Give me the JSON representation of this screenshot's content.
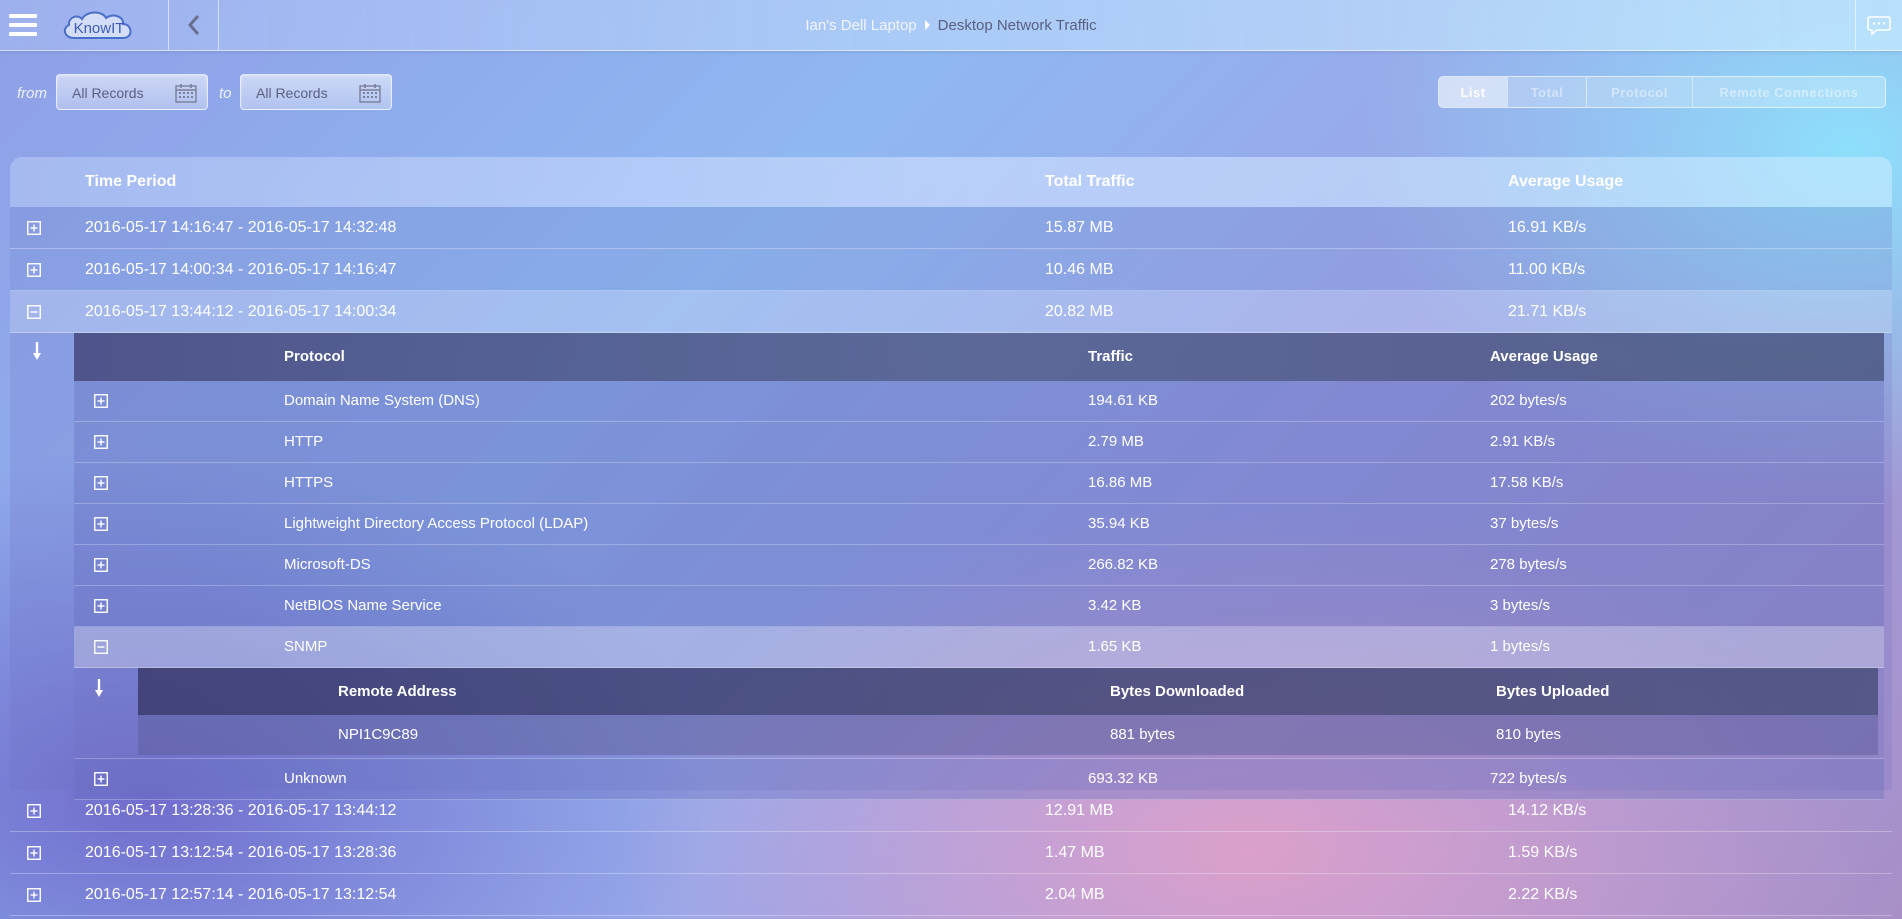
{
  "header": {
    "logo_text": "KnowIT",
    "breadcrumb_device": "Ian's Dell Laptop",
    "breadcrumb_page": "Desktop Network Traffic"
  },
  "filter": {
    "from_label": "from",
    "from_value": "All Records",
    "to_label": "to",
    "to_value": "All Records"
  },
  "view_tabs": [
    "List",
    "Total",
    "Protocol",
    "Remote Connections"
  ],
  "active_tab": "List",
  "table": {
    "columns": [
      "Time Period",
      "Total Traffic",
      "Average Usage"
    ],
    "rows_before": [
      {
        "period": "2016-05-17 14:16:47 - 2016-05-17 14:32:48",
        "traffic": "15.87 MB",
        "avg": "16.91 KB/s"
      },
      {
        "period": "2016-05-17 14:00:34 - 2016-05-17 14:16:47",
        "traffic": "10.46 MB",
        "avg": "11.00 KB/s"
      }
    ],
    "expanded_row": {
      "period": "2016-05-17 13:44:12 - 2016-05-17 14:00:34",
      "traffic": "20.82 MB",
      "avg": "21.71 KB/s"
    },
    "rows_after": [
      {
        "period": "2016-05-17 13:28:36 - 2016-05-17 13:44:12",
        "traffic": "12.91 MB",
        "avg": "14.12 KB/s"
      },
      {
        "period": "2016-05-17 13:12:54 - 2016-05-17 13:28:36",
        "traffic": "1.47 MB",
        "avg": "1.59 KB/s"
      },
      {
        "period": "2016-05-17 12:57:14 - 2016-05-17 13:12:54",
        "traffic": "2.04 MB",
        "avg": "2.22 KB/s"
      }
    ]
  },
  "protocols": {
    "columns": [
      "Protocol",
      "Traffic",
      "Average Usage"
    ],
    "rows_before": [
      {
        "name": "Domain Name System (DNS)",
        "traffic": "194.61 KB",
        "avg": "202 bytes/s"
      },
      {
        "name": "HTTP",
        "traffic": "2.79 MB",
        "avg": "2.91 KB/s"
      },
      {
        "name": "HTTPS",
        "traffic": "16.86 MB",
        "avg": "17.58 KB/s"
      },
      {
        "name": "Lightweight Directory Access Protocol (LDAP)",
        "traffic": "35.94 KB",
        "avg": "37 bytes/s"
      },
      {
        "name": "Microsoft-DS",
        "traffic": "266.82 KB",
        "avg": "278 bytes/s"
      },
      {
        "name": "NetBIOS Name Service",
        "traffic": "3.42 KB",
        "avg": "3 bytes/s"
      }
    ],
    "expanded_row": {
      "name": "SNMP",
      "traffic": "1.65 KB",
      "avg": "1 bytes/s"
    },
    "rows_after": [
      {
        "name": "Unknown",
        "traffic": "693.32 KB",
        "avg": "722 bytes/s"
      }
    ]
  },
  "remote": {
    "columns": [
      "Remote Address",
      "Bytes Downloaded",
      "Bytes Uploaded"
    ],
    "rows": [
      {
        "address": "NPI1C9C89",
        "down": "881 bytes",
        "up": "810 bytes"
      }
    ]
  }
}
